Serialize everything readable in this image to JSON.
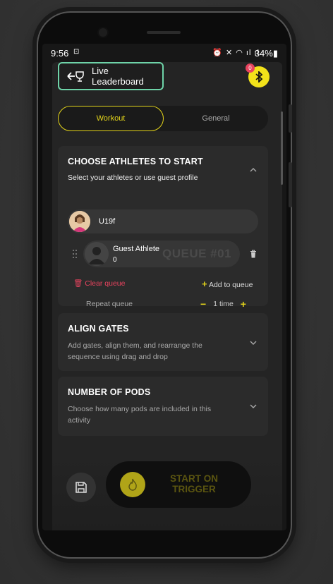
{
  "status_bar": {
    "time": "9:56",
    "recording_icon": "screen-record-icon",
    "icons": "⏰ ✕ ◠ ıl ıl",
    "battery": "34%▮"
  },
  "header": {
    "leaderboard_label": "Live Leaderboard",
    "bluetooth_badge": "0"
  },
  "tabs": [
    {
      "label": "Workout",
      "active": true
    },
    {
      "label": "General",
      "active": false
    }
  ],
  "choose_athletes": {
    "title": "CHOOSE ATHLETES TO START",
    "subtitle": "Select your athletes or use guest profile",
    "athlete": {
      "name": "U19f"
    },
    "guest": {
      "name": "Guest Athlete",
      "score": "0",
      "queue_label": "QUEUE #01"
    },
    "clear_queue": "Clear queue",
    "add_to_queue": "Add to queue",
    "repeat_label": "Repeat queue",
    "repeat_value": "1 time"
  },
  "align_gates": {
    "title": "ALIGN GATES",
    "description": "Add gates, align them, and rearrange the sequence using drag and drop"
  },
  "number_of_pods": {
    "title": "NUMBER OF PODS",
    "description": "Choose how many pods are included in this activity"
  },
  "actions": {
    "start_line1": "START ON",
    "start_line2": "TRIGGER"
  },
  "colors": {
    "accent_yellow": "#e3d41a",
    "leaderboard_border": "#6ed3a8",
    "danger_red": "#e8435e"
  }
}
